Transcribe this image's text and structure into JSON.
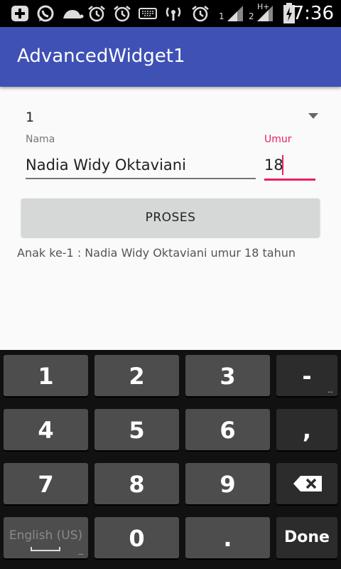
{
  "status_bar": {
    "icons": [
      "add-box-icon",
      "whatsapp-icon",
      "turtle-icon",
      "alarm-icon",
      "alarm-icon",
      "keyboard-icon",
      "wifi-hotspot-icon",
      "alarm-icon",
      "signal-icon",
      "signal-icon",
      "battery-charging-icon"
    ],
    "sim1_label": "1",
    "sim2_label": "2",
    "network_type": "H+",
    "clock": "7:36"
  },
  "app_bar": {
    "title": "AdvancedWidget1",
    "color": "#3f51b5"
  },
  "form": {
    "spinner_value": "1",
    "nama_label": "Nama",
    "nama_value": "Nadia Widy Oktaviani",
    "umur_label": "Umur",
    "umur_value": "18",
    "accent_color": "#e91e63"
  },
  "proses_button": {
    "label": "PROSES"
  },
  "result_text": "Anak ke-1 : Nadia Widy Oktaviani umur 18 tahun",
  "keyboard": {
    "rows": [
      [
        "1",
        "2",
        "3",
        "-"
      ],
      [
        "4",
        "5",
        "6",
        ","
      ],
      [
        "7",
        "8",
        "9",
        "backspace-icon"
      ],
      [
        "English (US)",
        "0",
        ".",
        "Done"
      ]
    ],
    "more_indicator": "..."
  }
}
